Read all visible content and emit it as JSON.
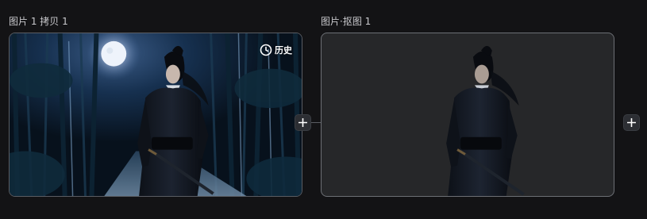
{
  "nodes": [
    {
      "title": "图片 1 拷贝 1",
      "history_label": "历史",
      "history_icon": "history-clock-icon"
    },
    {
      "title": "图片·抠图 1"
    }
  ],
  "icons": {
    "plus": "plus-icon"
  },
  "colors": {
    "background": "#131315",
    "card_border": "#5a5d63",
    "output_card_bg": "#262729",
    "title_text": "#c9c9cd",
    "plus_button_bg": "#2c2e33"
  }
}
